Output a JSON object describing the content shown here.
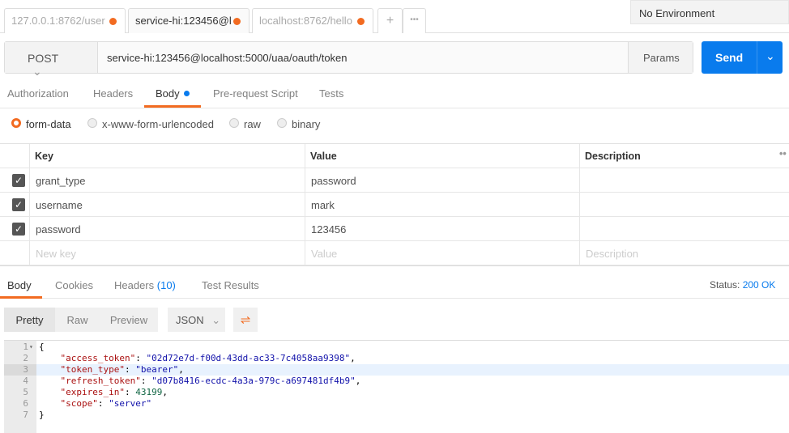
{
  "tabs": [
    {
      "label": "127.0.0.1:8762/user"
    },
    {
      "label": "service-hi:123456@l"
    },
    {
      "label": "localhost:8762/hello"
    }
  ],
  "tab_actions": {
    "add": "+",
    "more": "•••"
  },
  "environment": "No Environment",
  "request": {
    "method": "POST",
    "url": "service-hi:123456@localhost:5000/uaa/oauth/token",
    "params": "Params",
    "send": "Send"
  },
  "subtabs": [
    "Authorization",
    "Headers",
    "Body",
    "Pre-request Script",
    "Tests"
  ],
  "body_modes": [
    "form-data",
    "x-www-form-urlencoded",
    "raw",
    "binary"
  ],
  "table": {
    "headers": [
      "Key",
      "Value",
      "Description"
    ],
    "rows": [
      {
        "key": "grant_type",
        "value": "password"
      },
      {
        "key": "username",
        "value": "mark"
      },
      {
        "key": "password",
        "value": "123456"
      }
    ],
    "placeholders": {
      "key": "New key",
      "value": "Value",
      "description": "Description"
    }
  },
  "response": {
    "tabs": [
      "Body",
      "Cookies",
      "Headers",
      "Test Results"
    ],
    "headers_count": "(10)",
    "status_label": "Status:",
    "status": "200 OK",
    "views": [
      "Pretty",
      "Raw",
      "Preview"
    ],
    "format": "JSON"
  },
  "code": {
    "lines": [
      "{",
      "    \"access_token\": \"02d72e7d-f00d-43dd-ac33-7c4058aa9398\",",
      "    \"token_type\": \"bearer\",",
      "    \"refresh_token\": \"d07b8416-ecdc-4a3a-979c-a697481df4b9\",",
      "    \"expires_in\": 43199,",
      "    \"scope\": \"server\"",
      "}"
    ]
  },
  "colors": {
    "accent": "#f26b21",
    "send": "#097bed"
  }
}
